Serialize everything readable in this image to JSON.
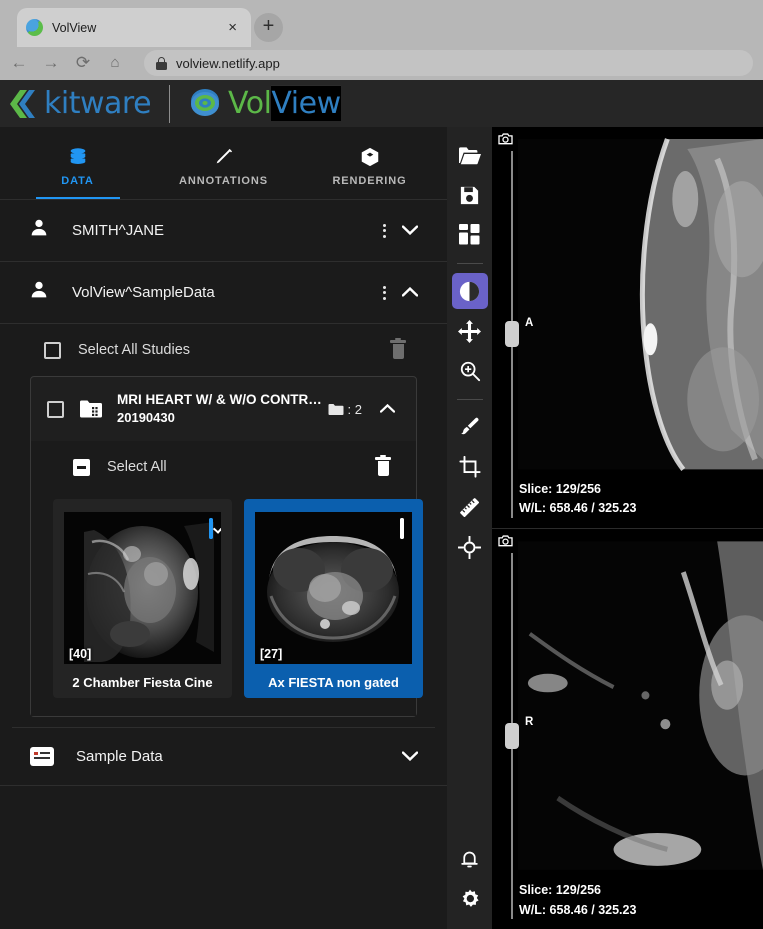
{
  "browser": {
    "tab_title": "VolView",
    "favicon_icon": "volview-favicon",
    "close_icon": "×",
    "new_tab_icon": "+",
    "back_icon": "←",
    "forward_icon": "→",
    "reload_icon": "⟳",
    "home_icon": "⌂",
    "lock_icon": "lock-icon",
    "url": "volview.netlify.app"
  },
  "header": {
    "brand_kitware": "kitware",
    "brand_vol": "Vol",
    "brand_view": "View"
  },
  "tabs": [
    {
      "label": "DATA",
      "icon": "database-icon",
      "active": true
    },
    {
      "label": "ANNOTATIONS",
      "icon": "pencil-icon",
      "active": false
    },
    {
      "label": "RENDERING",
      "icon": "cube-icon",
      "active": false
    }
  ],
  "sidebar": {
    "patients": [
      {
        "name": "SMITH^JANE",
        "expanded": false,
        "chevron": "chevron-down"
      },
      {
        "name": "VolView^SampleData",
        "expanded": true,
        "chevron": "chevron-up"
      }
    ],
    "select_all_studies_label": "Select All Studies",
    "study": {
      "name": "MRI HEART W/ & W/O CONTR…",
      "date": "20190430",
      "count_label": ": 2",
      "chevron": "chevron-up",
      "select_all_label": "Select All"
    },
    "series": [
      {
        "name": "2 Chamber Fiesta Cine",
        "index_label": "[40]",
        "checked": true,
        "selected": false
      },
      {
        "name": "Ax FIESTA non gated",
        "index_label": "[27]",
        "checked": false,
        "selected": true
      }
    ],
    "sample_data_label": "Sample Data",
    "sample_data_chevron": "chevron-down"
  },
  "toolrail": {
    "tools": [
      {
        "name": "open-files-icon",
        "active": false
      },
      {
        "name": "save-session-icon",
        "active": false
      },
      {
        "name": "layout-grid-icon",
        "active": false
      },
      {
        "name": "window-level-icon",
        "active": true
      },
      {
        "name": "pan-icon",
        "active": false
      },
      {
        "name": "zoom-icon",
        "active": false
      },
      {
        "name": "paint-brush-icon",
        "active": false
      },
      {
        "name": "crop-icon",
        "active": false
      },
      {
        "name": "ruler-icon",
        "active": false
      },
      {
        "name": "crosshairs-icon",
        "active": false
      }
    ],
    "bottom_tools": [
      {
        "name": "notifications-bell-icon"
      },
      {
        "name": "settings-gear-icon"
      }
    ]
  },
  "viewports": [
    {
      "orientation_label": "A",
      "slice_text": "Slice: 129/256",
      "wl_text": "W/L: 658.46 / 325.23",
      "camera_icon": "screenshot-camera-icon",
      "slider_percent": 50
    },
    {
      "orientation_label": "R",
      "slice_text": "Slice: 129/256",
      "wl_text": "W/L: 658.46 / 325.23",
      "camera_icon": "screenshot-camera-icon",
      "slider_percent": 50
    }
  ],
  "colors": {
    "accent_blue": "#2196f3",
    "active_tool_purple": "#6a62c8",
    "selected_card_blue": "#0b5fae",
    "brand_blue": "#2f7fc1",
    "brand_green": "#5cb848"
  }
}
